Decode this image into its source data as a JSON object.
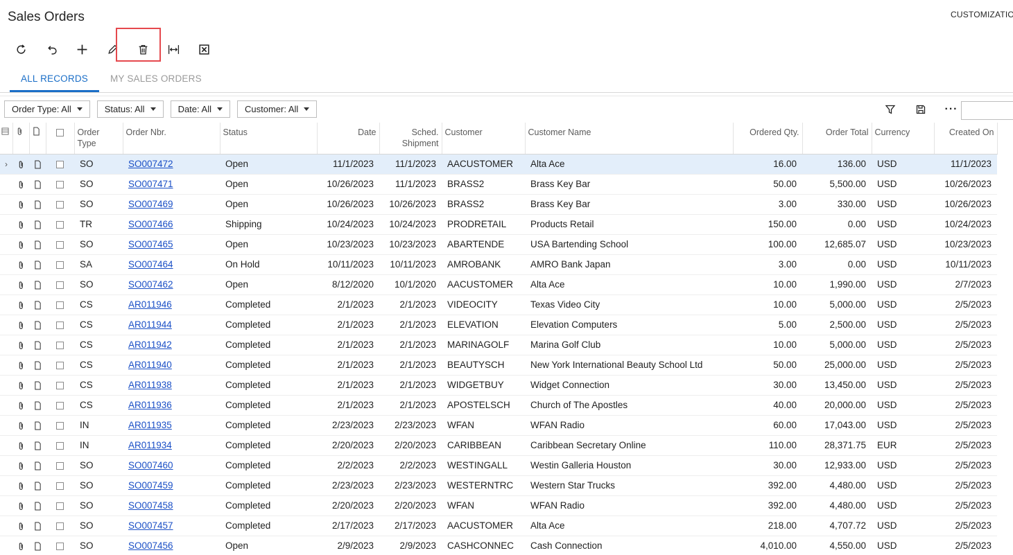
{
  "header": {
    "title": "Sales Orders",
    "customization": "CUSTOMIZATION"
  },
  "toolbar": {
    "buttons": [
      {
        "name": "refresh-icon"
      },
      {
        "name": "undo-icon"
      },
      {
        "name": "add-icon"
      },
      {
        "name": "edit-icon"
      },
      {
        "name": "trash-icon"
      },
      {
        "name": "fit-columns-icon"
      },
      {
        "name": "excel-export-icon"
      }
    ]
  },
  "tabs": [
    {
      "label": "ALL RECORDS",
      "active": true
    },
    {
      "label": "MY SALES ORDERS",
      "active": false
    }
  ],
  "filters": [
    {
      "label": "Order Type: All"
    },
    {
      "label": "Status: All"
    },
    {
      "label": "Date: All"
    },
    {
      "label": "Customer: All"
    }
  ],
  "grid": {
    "columns": {
      "order_type": "Order Type",
      "order_nbr": "Order Nbr.",
      "status": "Status",
      "date": "Date",
      "sched_shipment": "Sched. Shipment",
      "customer": "Customer",
      "customer_name": "Customer Name",
      "ordered_qty": "Ordered Qty.",
      "order_total": "Order Total",
      "currency": "Currency",
      "created_on": "Created On"
    },
    "rows": [
      {
        "type": "SO",
        "nbr": "SO007472",
        "status": "Open",
        "date": "11/1/2023",
        "sched": "11/1/2023",
        "customer": "AACUSTOMER",
        "name": "Alta Ace",
        "qty": "16.00",
        "total": "136.00",
        "currency": "USD",
        "created": "11/1/2023"
      },
      {
        "type": "SO",
        "nbr": "SO007471",
        "status": "Open",
        "date": "10/26/2023",
        "sched": "11/1/2023",
        "customer": "BRASS2",
        "name": "Brass Key Bar",
        "qty": "50.00",
        "total": "5,500.00",
        "currency": "USD",
        "created": "10/26/2023"
      },
      {
        "type": "SO",
        "nbr": "SO007469",
        "status": "Open",
        "date": "10/26/2023",
        "sched": "10/26/2023",
        "customer": "BRASS2",
        "name": "Brass Key Bar",
        "qty": "3.00",
        "total": "330.00",
        "currency": "USD",
        "created": "10/26/2023"
      },
      {
        "type": "TR",
        "nbr": "SO007466",
        "status": "Shipping",
        "date": "10/24/2023",
        "sched": "10/24/2023",
        "customer": "PRODRETAIL",
        "name": "Products Retail",
        "qty": "150.00",
        "total": "0.00",
        "currency": "USD",
        "created": "10/24/2023"
      },
      {
        "type": "SO",
        "nbr": "SO007465",
        "status": "Open",
        "date": "10/23/2023",
        "sched": "10/23/2023",
        "customer": "ABARTENDE",
        "name": "USA Bartending School",
        "qty": "100.00",
        "total": "12,685.07",
        "currency": "USD",
        "created": "10/23/2023"
      },
      {
        "type": "SA",
        "nbr": "SO007464",
        "status": "On Hold",
        "date": "10/11/2023",
        "sched": "10/11/2023",
        "customer": "AMROBANK",
        "name": "AMRO Bank Japan",
        "qty": "3.00",
        "total": "0.00",
        "currency": "USD",
        "created": "10/11/2023"
      },
      {
        "type": "SO",
        "nbr": "SO007462",
        "status": "Open",
        "date": "8/12/2020",
        "sched": "10/1/2020",
        "customer": "AACUSTOMER",
        "name": "Alta Ace",
        "qty": "10.00",
        "total": "1,990.00",
        "currency": "USD",
        "created": "2/7/2023"
      },
      {
        "type": "CS",
        "nbr": "AR011946",
        "status": "Completed",
        "date": "2/1/2023",
        "sched": "2/1/2023",
        "customer": "VIDEOCITY",
        "name": "Texas Video City",
        "qty": "10.00",
        "total": "5,000.00",
        "currency": "USD",
        "created": "2/5/2023"
      },
      {
        "type": "CS",
        "nbr": "AR011944",
        "status": "Completed",
        "date": "2/1/2023",
        "sched": "2/1/2023",
        "customer": "ELEVATION",
        "name": "Elevation Computers",
        "qty": "5.00",
        "total": "2,500.00",
        "currency": "USD",
        "created": "2/5/2023"
      },
      {
        "type": "CS",
        "nbr": "AR011942",
        "status": "Completed",
        "date": "2/1/2023",
        "sched": "2/1/2023",
        "customer": "MARINAGOLF",
        "name": "Marina Golf Club",
        "qty": "10.00",
        "total": "5,000.00",
        "currency": "USD",
        "created": "2/5/2023"
      },
      {
        "type": "CS",
        "nbr": "AR011940",
        "status": "Completed",
        "date": "2/1/2023",
        "sched": "2/1/2023",
        "customer": "BEAUTYSCH",
        "name": "New York International Beauty School Ltd",
        "qty": "50.00",
        "total": "25,000.00",
        "currency": "USD",
        "created": "2/5/2023"
      },
      {
        "type": "CS",
        "nbr": "AR011938",
        "status": "Completed",
        "date": "2/1/2023",
        "sched": "2/1/2023",
        "customer": "WIDGETBUY",
        "name": "Widget Connection",
        "qty": "30.00",
        "total": "13,450.00",
        "currency": "USD",
        "created": "2/5/2023"
      },
      {
        "type": "CS",
        "nbr": "AR011936",
        "status": "Completed",
        "date": "2/1/2023",
        "sched": "2/1/2023",
        "customer": "APOSTELSCH",
        "name": "Church of The Apostles",
        "qty": "40.00",
        "total": "20,000.00",
        "currency": "USD",
        "created": "2/5/2023"
      },
      {
        "type": "IN",
        "nbr": "AR011935",
        "status": "Completed",
        "date": "2/23/2023",
        "sched": "2/23/2023",
        "customer": "WFAN",
        "name": "WFAN Radio",
        "qty": "60.00",
        "total": "17,043.00",
        "currency": "USD",
        "created": "2/5/2023"
      },
      {
        "type": "IN",
        "nbr": "AR011934",
        "status": "Completed",
        "date": "2/20/2023",
        "sched": "2/20/2023",
        "customer": "CARIBBEAN",
        "name": "Caribbean Secretary Online",
        "qty": "110.00",
        "total": "28,371.75",
        "currency": "EUR",
        "created": "2/5/2023"
      },
      {
        "type": "SO",
        "nbr": "SO007460",
        "status": "Completed",
        "date": "2/2/2023",
        "sched": "2/2/2023",
        "customer": "WESTINGALL",
        "name": "Westin Galleria Houston",
        "qty": "30.00",
        "total": "12,933.00",
        "currency": "USD",
        "created": "2/5/2023"
      },
      {
        "type": "SO",
        "nbr": "SO007459",
        "status": "Completed",
        "date": "2/23/2023",
        "sched": "2/23/2023",
        "customer": "WESTERNTRC",
        "name": "Western Star Trucks",
        "qty": "392.00",
        "total": "4,480.00",
        "currency": "USD",
        "created": "2/5/2023"
      },
      {
        "type": "SO",
        "nbr": "SO007458",
        "status": "Completed",
        "date": "2/20/2023",
        "sched": "2/20/2023",
        "customer": "WFAN",
        "name": "WFAN Radio",
        "qty": "392.00",
        "total": "4,480.00",
        "currency": "USD",
        "created": "2/5/2023"
      },
      {
        "type": "SO",
        "nbr": "SO007457",
        "status": "Completed",
        "date": "2/17/2023",
        "sched": "2/17/2023",
        "customer": "AACUSTOMER",
        "name": "Alta Ace",
        "qty": "218.00",
        "total": "4,707.72",
        "currency": "USD",
        "created": "2/5/2023"
      },
      {
        "type": "SO",
        "nbr": "SO007456",
        "status": "Open",
        "date": "2/9/2023",
        "sched": "2/9/2023",
        "customer": "CASHCONNEC",
        "name": "Cash Connection",
        "qty": "4,010.00",
        "total": "4,550.00",
        "currency": "USD",
        "created": "2/5/2023"
      }
    ]
  }
}
